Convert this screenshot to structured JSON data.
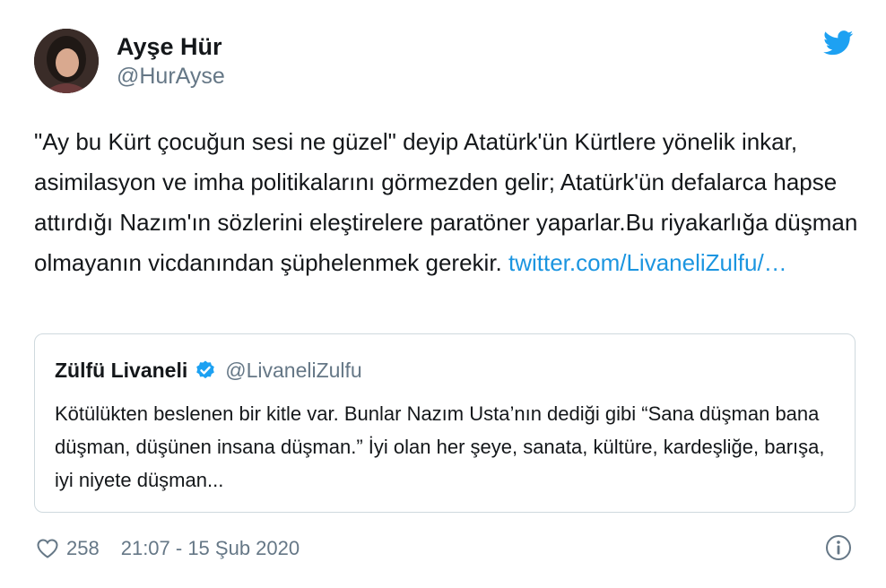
{
  "author": {
    "display_name": "Ayşe Hür",
    "handle": "@HurAyse"
  },
  "tweet": {
    "text": "\"Ay bu Kürt çocuğun sesi ne güzel\" deyip Atatürk'ün Kürtlere yönelik inkar, asimilasyon ve imha politikalarını görmezden gelir; Atatürk'ün defalarca hapse attırdığı Nazım'ın sözlerini eleştirelere paratöner yaparlar.Bu riyakarlığa düşman olmayanın vicdanından şüphelenmek gerekir.",
    "link_text": "twitter.com/LivaneliZulfu/…"
  },
  "quoted_tweet": {
    "display_name": "Zülfü Livaneli",
    "handle": "@LivaneliZulfu",
    "text": "Kötülükten beslenen bir kitle var. Bunlar Nazım Usta’nın dediği gibi “Sana düşman bana düşman, düşünen insana düşman.” İyi olan her şeye, sanata, kültüre, kardeşliğe, barışa, iyi niyete düşman..."
  },
  "footer": {
    "likes": "258",
    "timestamp": "21:07 - 15 Şub 2020"
  },
  "colors": {
    "link": "#1b95e0",
    "twitter_blue": "#1da1f2",
    "secondary_text": "#657786",
    "border": "#cfd9de"
  },
  "icons": {
    "brand": "twitter-bird-icon",
    "verified": "verified-badge-icon",
    "like": "heart-icon",
    "info": "info-icon"
  }
}
